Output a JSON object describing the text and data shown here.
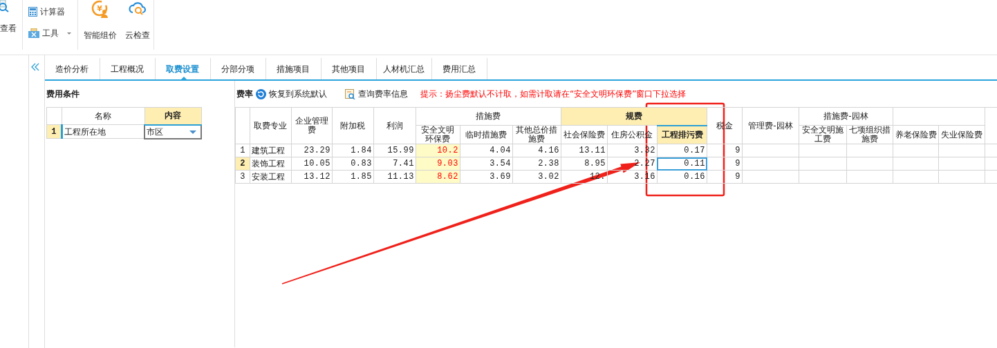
{
  "toolbar": {
    "view": "查看",
    "calculator": "计算器",
    "tools": "工具",
    "smart_pricing": "智能组价",
    "smart_pricing_symbol": "¥",
    "cloud_check": "云检查"
  },
  "tabs": [
    {
      "label": "造价分析",
      "selected": false
    },
    {
      "label": "工程概况",
      "selected": false
    },
    {
      "label": "取费设置",
      "selected": true
    },
    {
      "label": "分部分项",
      "selected": false
    },
    {
      "label": "措施项目",
      "selected": false
    },
    {
      "label": "其他项目",
      "selected": false
    },
    {
      "label": "人材机汇总",
      "selected": false
    },
    {
      "label": "费用汇总",
      "selected": false
    }
  ],
  "conditions": {
    "title": "费用条件",
    "columns": [
      {
        "label": "名称",
        "highlighted": false
      },
      {
        "label": "内容",
        "highlighted": true
      }
    ],
    "rows": [
      {
        "index": "1",
        "name": "工程所在地",
        "value": "市区",
        "selected": true
      }
    ]
  },
  "rates": {
    "title": "费率",
    "restore_button": "恢复到系统默认",
    "query_button": "查询费率信息",
    "hint": "提示：扬尘费默认不计取，如需计取请在“安全文明环保费”窗口下拉选择",
    "columns": [
      {
        "label": "取费专业"
      },
      {
        "label": "企业管理费"
      },
      {
        "label": "附加税"
      },
      {
        "label": "利润"
      },
      {
        "label": "措施费",
        "children": [
          {
            "label": "安全文明环保费",
            "custom": true
          },
          {
            "label": "临时措施费"
          },
          {
            "label": "其他总价措施费"
          }
        ]
      },
      {
        "label": "规费",
        "highlighted": true,
        "children": [
          {
            "label": "社会保险费"
          },
          {
            "label": "住房公积金"
          },
          {
            "label": "工程排污费",
            "highlighted": true
          }
        ]
      },
      {
        "label": "税金"
      },
      {
        "label": "管理费-园林"
      },
      {
        "label": "措施费-园林",
        "children": [
          {
            "label": "安全文明施工费"
          },
          {
            "label": "七项组织措施费"
          }
        ]
      },
      {
        "children": [
          {
            "label": "养老保险费"
          },
          {
            "label": "失业保险费"
          }
        ]
      }
    ],
    "rows": [
      {
        "index": "1",
        "selected": false,
        "values": [
          "建筑工程",
          "23.29",
          "1.84",
          "15.99",
          "10.2",
          "4.04",
          "4.16",
          "13.11",
          "3.32",
          "0.17",
          "9"
        ]
      },
      {
        "index": "2",
        "selected": true,
        "values": [
          "装饰工程",
          "10.05",
          "0.83",
          "7.41",
          "9.03",
          "3.54",
          "2.38",
          "8.95",
          "2.27",
          "0.11",
          "9"
        ]
      },
      {
        "index": "3",
        "selected": false,
        "values": [
          "安装工程",
          "13.12",
          "1.85",
          "11.13",
          "8.62",
          "3.69",
          "3.02",
          "12.",
          "3.16",
          "0.16",
          "9"
        ]
      }
    ]
  },
  "annotations": [
    {
      "kind": "box"
    },
    {
      "kind": "arrow"
    }
  ]
}
